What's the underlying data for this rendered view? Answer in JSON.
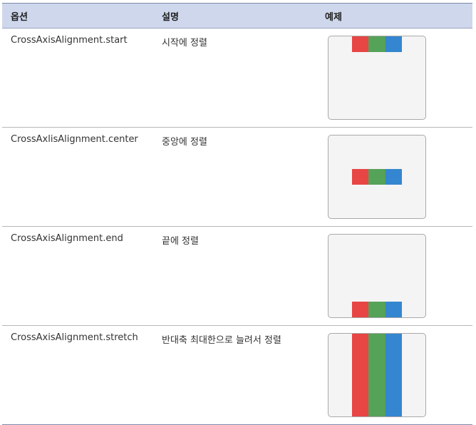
{
  "header": {
    "col1": "옵션",
    "col2": "설명",
    "col3": "예제"
  },
  "rows": [
    {
      "option": "CrossAxisAlignment.start",
      "description": "시작에 정렬",
      "mode": "start"
    },
    {
      "option": "CrossAxlisAlignment.center",
      "description": "중앙에 정렬",
      "mode": "center"
    },
    {
      "option": "CrossAxisAlignment.end",
      "description": "끝에 정렬",
      "mode": "end"
    },
    {
      "option": "CrossAxisAlignment.stretch",
      "description": "반대축 최대한으로 늘려서 정렬",
      "mode": "stretch"
    }
  ],
  "colors": {
    "red": "#e84545",
    "green": "#55a259",
    "blue": "#3486d0",
    "header_bg": "#cfd7ec"
  }
}
